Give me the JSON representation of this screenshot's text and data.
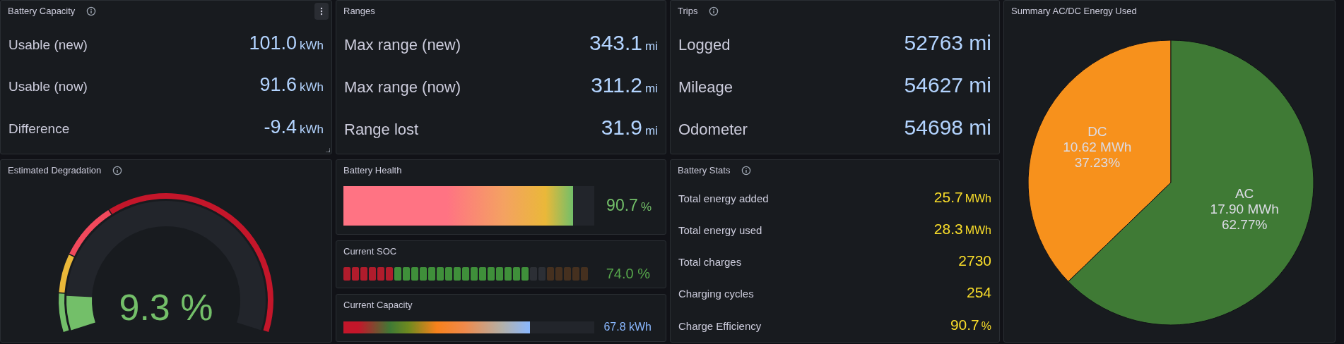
{
  "battery_capacity": {
    "title": "Battery Capacity",
    "info_icon": true,
    "hovered": true,
    "items": [
      {
        "label": "Usable (new)",
        "value": "101.0",
        "unit": "kWh"
      },
      {
        "label": "Usable (now)",
        "value": "91.6",
        "unit": "kWh"
      },
      {
        "label": "Difference",
        "value": "-9.4",
        "unit": "kWh"
      }
    ]
  },
  "ranges": {
    "title": "Ranges",
    "items": [
      {
        "label": "Max range (new)",
        "value": "343.1",
        "unit": "mi"
      },
      {
        "label": "Max range (now)",
        "value": "311.2",
        "unit": "mi"
      },
      {
        "label": "Range lost",
        "value": "31.9",
        "unit": "mi"
      }
    ]
  },
  "trips": {
    "title": "Trips",
    "info_icon": true,
    "items": [
      {
        "label": "Logged",
        "value": "52763 mi"
      },
      {
        "label": "Mileage",
        "value": "54627 mi"
      },
      {
        "label": "Odometer",
        "value": "54698 mi"
      }
    ]
  },
  "estimated_degradation": {
    "title": "Estimated Degradation",
    "info_icon": true,
    "value": "9.3 %"
  },
  "battery_health": {
    "title": "Battery Health",
    "value": "90.7",
    "unit": "%",
    "level": 0.915
  },
  "current_soc": {
    "title": "Current SOC",
    "value": "74.0 %",
    "level": 0.74
  },
  "current_capacity": {
    "title": "Current Capacity",
    "value": "67.8 kWh",
    "level": 0.745
  },
  "battery_stats": {
    "title": "Battery Stats",
    "info_icon": true,
    "items": [
      {
        "label": "Total energy added",
        "value": "25.7",
        "unit": "MWh"
      },
      {
        "label": "Total energy used",
        "value": "28.3",
        "unit": "MWh"
      },
      {
        "label": "Total charges",
        "value": "2730"
      },
      {
        "label": "Charging cycles",
        "value": "254"
      },
      {
        "label": "Charge Efficiency",
        "value": "90.7",
        "unit": "%"
      }
    ]
  },
  "energy_summary": {
    "title": "Summary AC/DC Energy Used",
    "chart_data": {
      "type": "pie",
      "categories": [
        "DC",
        "AC"
      ],
      "values": [
        10.62,
        17.9
      ],
      "colors": [
        "#f7911c",
        "#3f7a35"
      ],
      "value_labels": [
        "10.62 MWh",
        "17.90 MWh"
      ],
      "annotations": [
        {
          "x": "DC",
          "text": "37.23%"
        },
        {
          "x": "AC",
          "text": "62.77%"
        }
      ]
    }
  }
}
